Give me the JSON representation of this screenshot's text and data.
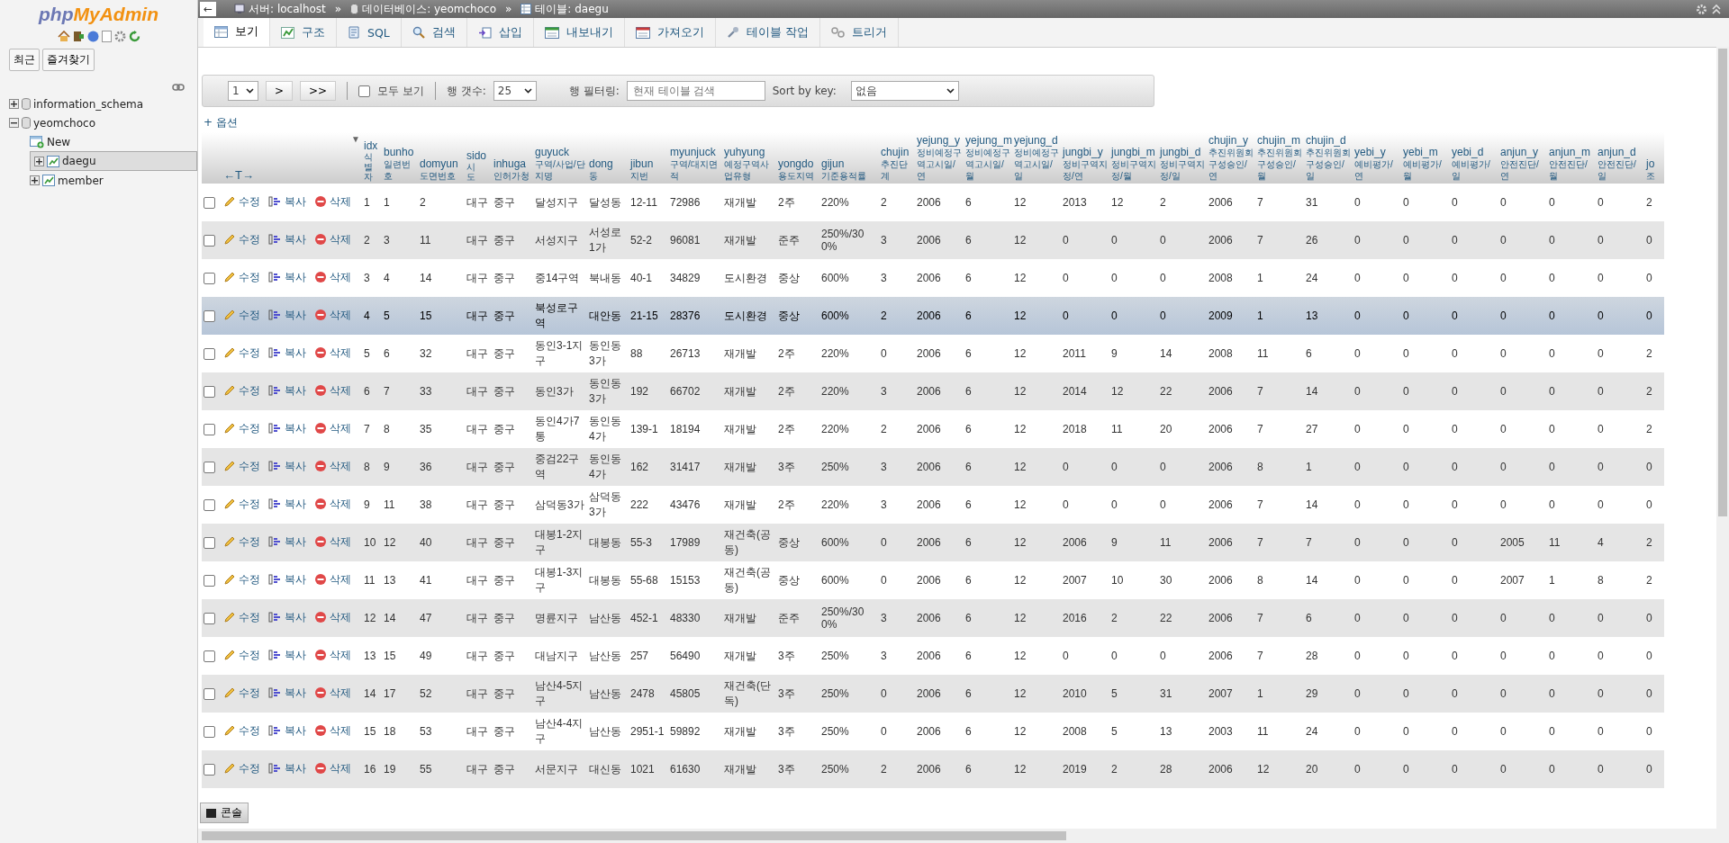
{
  "sidebar": {
    "logo": [
      "php",
      "MyAdmin"
    ],
    "buttons": [
      "최근",
      "즐겨찾기"
    ],
    "tree": [
      {
        "label": "information_schema",
        "kind": "database",
        "expanded": false,
        "selected": false
      },
      {
        "label": "yeomchoco",
        "kind": "database",
        "expanded": true,
        "selected": false,
        "children": [
          {
            "label": "New",
            "kind": "new",
            "selected": false
          },
          {
            "label": "daegu",
            "kind": "table",
            "expanded": false,
            "selected": true
          },
          {
            "label": "member",
            "kind": "table",
            "expanded": false,
            "selected": false
          }
        ]
      }
    ]
  },
  "topbar": {
    "back": "←",
    "crumbs": [
      {
        "kind": "server",
        "label": "서버: localhost"
      },
      {
        "kind": "database",
        "label": "데이터베이스: yeomchoco"
      },
      {
        "kind": "table",
        "label": "테이블: daegu"
      }
    ],
    "separator": "»"
  },
  "tabs": [
    {
      "kind": "browse",
      "label": "보기",
      "selected": true
    },
    {
      "kind": "structure",
      "label": "구조",
      "selected": false
    },
    {
      "kind": "sql",
      "label": "SQL",
      "selected": false
    },
    {
      "kind": "search",
      "label": "검색",
      "selected": false
    },
    {
      "kind": "insert",
      "label": "삽입",
      "selected": false
    },
    {
      "kind": "export",
      "label": "내보내기",
      "selected": false
    },
    {
      "kind": "import",
      "label": "가져오기",
      "selected": false
    },
    {
      "kind": "operations",
      "label": "테이블 작업",
      "selected": false
    },
    {
      "kind": "triggers",
      "label": "트리거",
      "selected": false
    }
  ],
  "navigation": {
    "page": "1",
    "next": ">",
    "last": ">>",
    "show_all": {
      "label": "모두 보기",
      "checked": false
    },
    "rows_label": "행 갯수:",
    "rows": "25",
    "filter_label": "행 필터링:",
    "filter_placeholder": "현재 테이블 검색",
    "sort_label": "Sort by key:",
    "sort": "없음"
  },
  "options_link": "+ 옵션",
  "table": {
    "resize_handle": "←T→",
    "sort_marker": "▼",
    "columns": [
      {
        "name": "idx",
        "sub": "식별자",
        "vertical": true
      },
      {
        "name": "bunho",
        "sub": "일련번호",
        "vertical": false
      },
      {
        "name": "domyun",
        "sub": "도면번호",
        "vertical": false
      },
      {
        "name": "sido",
        "sub": "시도",
        "vertical": true
      },
      {
        "name": "inhuga",
        "sub": "인허가청",
        "vertical": false
      },
      {
        "name": "guyuck",
        "sub": "구역/사업/단지명",
        "vertical": false
      },
      {
        "name": "dong",
        "sub": "동",
        "vertical": false
      },
      {
        "name": "jibun",
        "sub": "지번",
        "vertical": false
      },
      {
        "name": "myunjuck",
        "sub": "구역/대지면적",
        "vertical": false
      },
      {
        "name": "yuhyung",
        "sub": "예정구역사업유형",
        "vertical": false
      },
      {
        "name": "yongdo",
        "sub": "용도지역",
        "vertical": false
      },
      {
        "name": "gijun",
        "sub": "기준용적률",
        "vertical": false
      },
      {
        "name": "chujin",
        "sub": "추진단계",
        "vertical": false
      },
      {
        "name": "yejung_y",
        "sub": "정비예정구역고시일/연",
        "vertical": false
      },
      {
        "name": "yejung_m",
        "sub": "정비예정구역고시일/월",
        "vertical": false
      },
      {
        "name": "yejung_d",
        "sub": "정비예정구역고시일/일",
        "vertical": false
      },
      {
        "name": "jungbi_y",
        "sub": "정비구역지정/연",
        "vertical": false
      },
      {
        "name": "jungbi_m",
        "sub": "정비구역지정/월",
        "vertical": false
      },
      {
        "name": "jungbi_d",
        "sub": "정비구역지정/일",
        "vertical": false
      },
      {
        "name": "chujin_y",
        "sub": "추진위원회구성승인/연",
        "vertical": false
      },
      {
        "name": "chujin_m",
        "sub": "추진위원회구성승인/월",
        "vertical": false
      },
      {
        "name": "chujin_d",
        "sub": "추진위원회구성승인/일",
        "vertical": false
      },
      {
        "name": "yebi_y",
        "sub": "예비평가/연",
        "vertical": false
      },
      {
        "name": "yebi_m",
        "sub": "예비평가/월",
        "vertical": false
      },
      {
        "name": "yebi_d",
        "sub": "예비평가/일",
        "vertical": false
      },
      {
        "name": "anjun_y",
        "sub": "안전진단/연",
        "vertical": false
      },
      {
        "name": "anjun_m",
        "sub": "안전진단/월",
        "vertical": false
      },
      {
        "name": "anjun_d",
        "sub": "안전진단/일",
        "vertical": false
      },
      {
        "name": "jo",
        "sub": "조",
        "vertical": false
      }
    ],
    "rows": [
      {
        "checked": false,
        "highlighted": false,
        "actions": [
          {
            "kind": "edit",
            "label": "수정"
          },
          {
            "kind": "copy",
            "label": "복사"
          },
          {
            "kind": "delete",
            "label": "삭제"
          }
        ],
        "cells": [
          "1",
          "1",
          "2",
          "대구",
          "중구",
          "달성지구",
          "달성동",
          "12-11",
          "72986",
          "재개발",
          "2주",
          "220%",
          "2",
          "2006",
          "6",
          "12",
          "2013",
          "12",
          "2",
          "2006",
          "7",
          "31",
          "0",
          "0",
          "0",
          "0",
          "0",
          "0",
          "2"
        ]
      },
      {
        "checked": false,
        "highlighted": false,
        "actions": [
          {
            "kind": "edit",
            "label": "수정"
          },
          {
            "kind": "copy",
            "label": "복사"
          },
          {
            "kind": "delete",
            "label": "삭제"
          }
        ],
        "cells": [
          "2",
          "3",
          "11",
          "대구",
          "중구",
          "서성지구",
          "서성로1가",
          "52-2",
          "96081",
          "재개발",
          "준주",
          "250%/300%",
          "3",
          "2006",
          "6",
          "12",
          "0",
          "0",
          "0",
          "2006",
          "7",
          "26",
          "0",
          "0",
          "0",
          "0",
          "0",
          "0",
          "0"
        ]
      },
      {
        "checked": false,
        "highlighted": false,
        "actions": [
          {
            "kind": "edit",
            "label": "수정"
          },
          {
            "kind": "copy",
            "label": "복사"
          },
          {
            "kind": "delete",
            "label": "삭제"
          }
        ],
        "cells": [
          "3",
          "4",
          "14",
          "대구",
          "중구",
          "중14구역",
          "북내동",
          "40-1",
          "34829",
          "도시환경",
          "중상",
          "600%",
          "3",
          "2006",
          "6",
          "12",
          "0",
          "0",
          "0",
          "2008",
          "1",
          "24",
          "0",
          "0",
          "0",
          "0",
          "0",
          "0",
          "0"
        ]
      },
      {
        "checked": false,
        "highlighted": true,
        "actions": [
          {
            "kind": "edit",
            "label": "수정"
          },
          {
            "kind": "copy",
            "label": "복사"
          },
          {
            "kind": "delete",
            "label": "삭제"
          }
        ],
        "cells": [
          "4",
          "5",
          "15",
          "대구",
          "중구",
          "북성로구역",
          "대안동",
          "21-15",
          "28376",
          "도시환경",
          "중상",
          "600%",
          "2",
          "2006",
          "6",
          "12",
          "0",
          "0",
          "0",
          "2009",
          "1",
          "13",
          "0",
          "0",
          "0",
          "0",
          "0",
          "0",
          "0"
        ]
      },
      {
        "checked": false,
        "highlighted": false,
        "actions": [
          {
            "kind": "edit",
            "label": "수정"
          },
          {
            "kind": "copy",
            "label": "복사"
          },
          {
            "kind": "delete",
            "label": "삭제"
          }
        ],
        "cells": [
          "5",
          "6",
          "32",
          "대구",
          "중구",
          "동인3-1지구",
          "동인동3가",
          "88",
          "26713",
          "재개발",
          "2주",
          "220%",
          "0",
          "2006",
          "6",
          "12",
          "2011",
          "9",
          "14",
          "2008",
          "11",
          "6",
          "0",
          "0",
          "0",
          "0",
          "0",
          "0",
          "2"
        ]
      },
      {
        "checked": false,
        "highlighted": false,
        "actions": [
          {
            "kind": "edit",
            "label": "수정"
          },
          {
            "kind": "copy",
            "label": "복사"
          },
          {
            "kind": "delete",
            "label": "삭제"
          }
        ],
        "cells": [
          "6",
          "7",
          "33",
          "대구",
          "중구",
          "동인3가",
          "동인동3가",
          "192",
          "66702",
          "재개발",
          "2주",
          "220%",
          "3",
          "2006",
          "6",
          "12",
          "2014",
          "12",
          "22",
          "2006",
          "7",
          "14",
          "0",
          "0",
          "0",
          "0",
          "0",
          "0",
          "2"
        ]
      },
      {
        "checked": false,
        "highlighted": false,
        "actions": [
          {
            "kind": "edit",
            "label": "수정"
          },
          {
            "kind": "copy",
            "label": "복사"
          },
          {
            "kind": "delete",
            "label": "삭제"
          }
        ],
        "cells": [
          "7",
          "8",
          "35",
          "대구",
          "중구",
          "동인4가7통",
          "동인동4가",
          "139-1",
          "18194",
          "재개발",
          "2주",
          "220%",
          "2",
          "2006",
          "6",
          "12",
          "2018",
          "11",
          "20",
          "2006",
          "7",
          "27",
          "0",
          "0",
          "0",
          "0",
          "0",
          "0",
          "2"
        ]
      },
      {
        "checked": false,
        "highlighted": false,
        "actions": [
          {
            "kind": "edit",
            "label": "수정"
          },
          {
            "kind": "copy",
            "label": "복사"
          },
          {
            "kind": "delete",
            "label": "삭제"
          }
        ],
        "cells": [
          "8",
          "9",
          "36",
          "대구",
          "중구",
          "중검22구역",
          "동인동4가",
          "162",
          "31417",
          "재개발",
          "3주",
          "250%",
          "3",
          "2006",
          "6",
          "12",
          "0",
          "0",
          "0",
          "2006",
          "8",
          "1",
          "0",
          "0",
          "0",
          "0",
          "0",
          "0",
          "0"
        ]
      },
      {
        "checked": false,
        "highlighted": false,
        "actions": [
          {
            "kind": "edit",
            "label": "수정"
          },
          {
            "kind": "copy",
            "label": "복사"
          },
          {
            "kind": "delete",
            "label": "삭제"
          }
        ],
        "cells": [
          "9",
          "11",
          "38",
          "대구",
          "중구",
          "삼덕동3가",
          "삼덕동3가",
          "222",
          "43476",
          "재개발",
          "2주",
          "220%",
          "3",
          "2006",
          "6",
          "12",
          "0",
          "0",
          "0",
          "2006",
          "7",
          "14",
          "0",
          "0",
          "0",
          "0",
          "0",
          "0",
          "0"
        ]
      },
      {
        "checked": false,
        "highlighted": false,
        "actions": [
          {
            "kind": "edit",
            "label": "수정"
          },
          {
            "kind": "copy",
            "label": "복사"
          },
          {
            "kind": "delete",
            "label": "삭제"
          }
        ],
        "cells": [
          "10",
          "12",
          "40",
          "대구",
          "중구",
          "대봉1-2지구",
          "대봉동",
          "55-3",
          "17989",
          "재건축(공동)",
          "중상",
          "600%",
          "0",
          "2006",
          "6",
          "12",
          "2006",
          "9",
          "11",
          "2006",
          "7",
          "7",
          "0",
          "0",
          "0",
          "2005",
          "11",
          "4",
          "2"
        ]
      },
      {
        "checked": false,
        "highlighted": false,
        "actions": [
          {
            "kind": "edit",
            "label": "수정"
          },
          {
            "kind": "copy",
            "label": "복사"
          },
          {
            "kind": "delete",
            "label": "삭제"
          }
        ],
        "cells": [
          "11",
          "13",
          "41",
          "대구",
          "중구",
          "대봉1-3지구",
          "대봉동",
          "55-68",
          "15153",
          "재건축(공동)",
          "중상",
          "600%",
          "0",
          "2006",
          "6",
          "12",
          "2007",
          "10",
          "30",
          "2006",
          "8",
          "14",
          "0",
          "0",
          "0",
          "2007",
          "1",
          "8",
          "2"
        ]
      },
      {
        "checked": false,
        "highlighted": false,
        "actions": [
          {
            "kind": "edit",
            "label": "수정"
          },
          {
            "kind": "copy",
            "label": "복사"
          },
          {
            "kind": "delete",
            "label": "삭제"
          }
        ],
        "cells": [
          "12",
          "14",
          "47",
          "대구",
          "중구",
          "명륜지구",
          "남산동",
          "452-1",
          "48330",
          "재개발",
          "준주",
          "250%/300%",
          "3",
          "2006",
          "6",
          "12",
          "2016",
          "2",
          "22",
          "2006",
          "7",
          "6",
          "0",
          "0",
          "0",
          "0",
          "0",
          "0",
          "0"
        ]
      },
      {
        "checked": false,
        "highlighted": false,
        "actions": [
          {
            "kind": "edit",
            "label": "수정"
          },
          {
            "kind": "copy",
            "label": "복사"
          },
          {
            "kind": "delete",
            "label": "삭제"
          }
        ],
        "cells": [
          "13",
          "15",
          "49",
          "대구",
          "중구",
          "대남지구",
          "남산동",
          "257",
          "56490",
          "재개발",
          "3주",
          "250%",
          "3",
          "2006",
          "6",
          "12",
          "0",
          "0",
          "0",
          "2006",
          "7",
          "28",
          "0",
          "0",
          "0",
          "0",
          "0",
          "0",
          "0"
        ]
      },
      {
        "checked": false,
        "highlighted": false,
        "actions": [
          {
            "kind": "edit",
            "label": "수정"
          },
          {
            "kind": "copy",
            "label": "복사"
          },
          {
            "kind": "delete",
            "label": "삭제"
          }
        ],
        "cells": [
          "14",
          "17",
          "52",
          "대구",
          "중구",
          "남산4-5지구",
          "남산동",
          "2478",
          "45805",
          "재건축(단독)",
          "3주",
          "250%",
          "0",
          "2006",
          "6",
          "12",
          "2010",
          "5",
          "31",
          "2007",
          "1",
          "29",
          "0",
          "0",
          "0",
          "0",
          "0",
          "0",
          "0"
        ]
      },
      {
        "checked": false,
        "highlighted": false,
        "actions": [
          {
            "kind": "edit",
            "label": "수정"
          },
          {
            "kind": "copy",
            "label": "복사"
          },
          {
            "kind": "delete",
            "label": "삭제"
          }
        ],
        "cells": [
          "15",
          "18",
          "53",
          "대구",
          "중구",
          "남산4-4지구",
          "남산동",
          "2951-1",
          "59892",
          "재개발",
          "3주",
          "250%",
          "0",
          "2006",
          "6",
          "12",
          "2008",
          "5",
          "13",
          "2003",
          "11",
          "24",
          "0",
          "0",
          "0",
          "0",
          "0",
          "0",
          "0"
        ]
      },
      {
        "checked": false,
        "highlighted": false,
        "actions": [
          {
            "kind": "edit",
            "label": "수정"
          },
          {
            "kind": "copy",
            "label": "복사"
          },
          {
            "kind": "delete",
            "label": "삭제"
          }
        ],
        "cells": [
          "16",
          "19",
          "55",
          "대구",
          "중구",
          "서문지구",
          "대신동",
          "1021",
          "61630",
          "재개발",
          "3주",
          "250%",
          "2",
          "2006",
          "6",
          "12",
          "2019",
          "2",
          "28",
          "2006",
          "12",
          "20",
          "0",
          "0",
          "0",
          "0",
          "0",
          "0",
          "0"
        ]
      }
    ]
  },
  "console": "콘솔"
}
